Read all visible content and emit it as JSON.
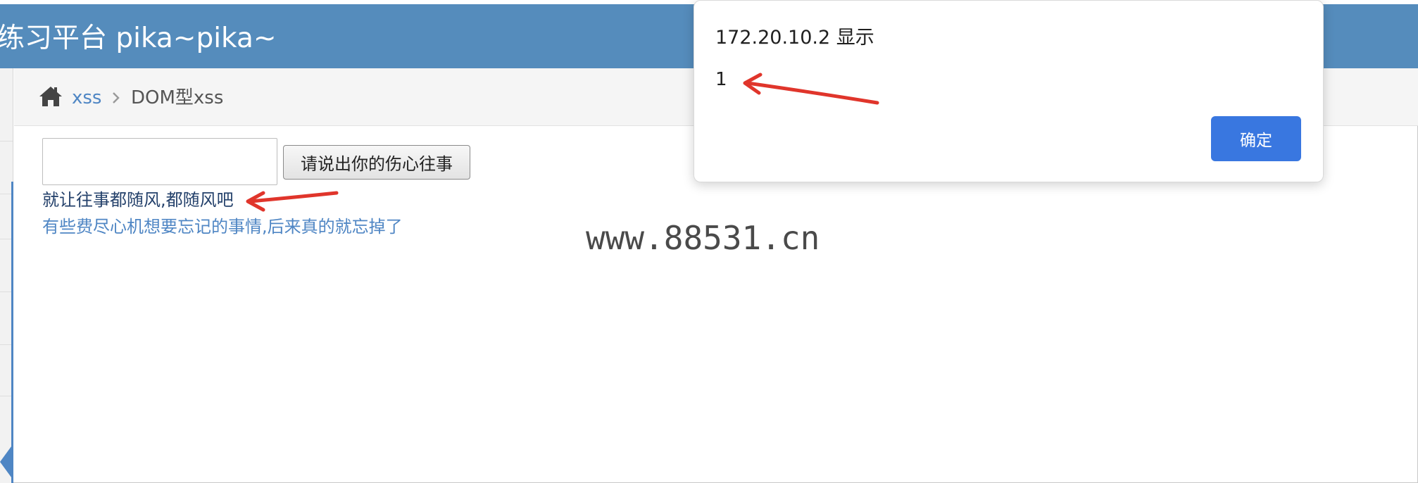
{
  "header": {
    "title": "练习平台 pika~pika~"
  },
  "breadcrumb": {
    "home_icon": "home-icon",
    "link": "xss",
    "separator_icon": "chevron-right-icon",
    "current": "DOM型xss"
  },
  "form": {
    "input_value": "",
    "button_label": "请说出你的伤心往事"
  },
  "result": {
    "text": "就让往事都随风,都随风吧",
    "link": "有些费尽心机想要忘记的事情,后来真的就忘掉了"
  },
  "watermark": "www.88531.cn",
  "dialog": {
    "title": "172.20.10.2 显示",
    "message": "1",
    "ok_label": "确定"
  },
  "colors": {
    "header_bg": "#558cbc",
    "accent_blue": "#4f86c4",
    "ok_button": "#3977e0",
    "annotation_arrow": "#e0352b"
  }
}
